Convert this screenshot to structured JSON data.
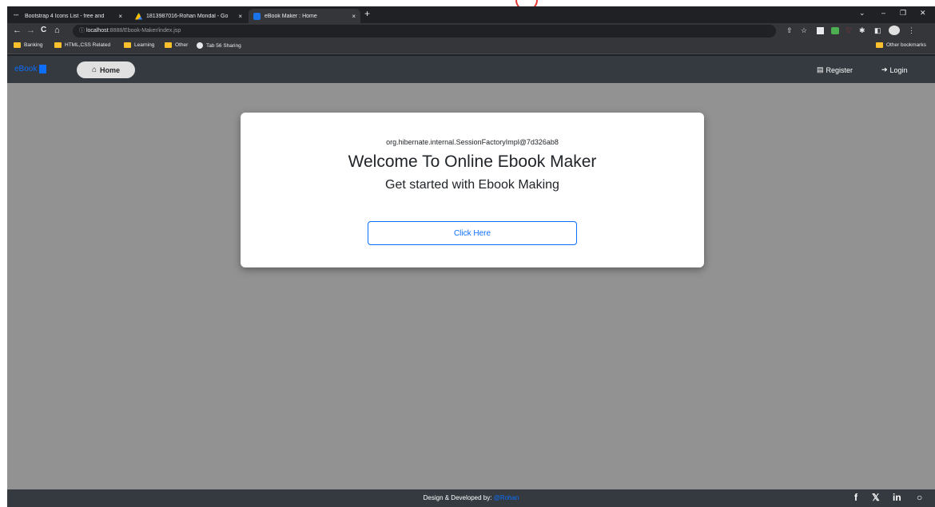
{
  "browser": {
    "tabs": [
      {
        "title": "Bootstrap 4 Icons List - free and",
        "close": "×",
        "favicon": "bootstrap-icon",
        "active": false
      },
      {
        "title": "1813987016-Rohan Mondal - Go",
        "close": "×",
        "favicon": "drive-icon",
        "active": false
      },
      {
        "title": "eBook Maker : Home",
        "close": "×",
        "favicon": "ebook-icon",
        "active": true
      }
    ],
    "new_tab": "+",
    "window_controls": {
      "dropdown": "⌄",
      "minimize": "–",
      "restore": "❐",
      "close": "✕"
    },
    "nav": {
      "back": "←",
      "forward": "→",
      "reload": "C",
      "home": "⌂",
      "info": "ⓘ"
    },
    "url_host": "localhost",
    "url_rest": ":8888/Ebook-Maker/index.jsp",
    "bookmarks": [
      "Banking",
      "HTML,CSS Related",
      "Learning",
      "Other",
      "Tab 56 Sharing"
    ],
    "other_bookmarks": "Other bookmarks"
  },
  "navbar": {
    "brand": "eBook",
    "home_icon": "⌂",
    "home_label": "Home",
    "register_icon": "▤",
    "register_label": "Register",
    "login_icon": "➔",
    "login_label": "Login"
  },
  "card": {
    "session": "org.hibernate.internal.SessionFactoryImpl@7d326ab8",
    "title": "Welcome To Online Ebook Maker",
    "subtitle": "Get started with Ebook Making",
    "button": "Click Here"
  },
  "footer": {
    "credit_prefix": "Design & Developed by: ",
    "credit_author": "@Rohan",
    "social": {
      "facebook": "f",
      "twitter": "𝕏",
      "linkedin": "in",
      "github": "○"
    }
  },
  "colors": {
    "accent": "#0d6efd",
    "navbar": "#343a40",
    "page_bg": "#929292"
  }
}
